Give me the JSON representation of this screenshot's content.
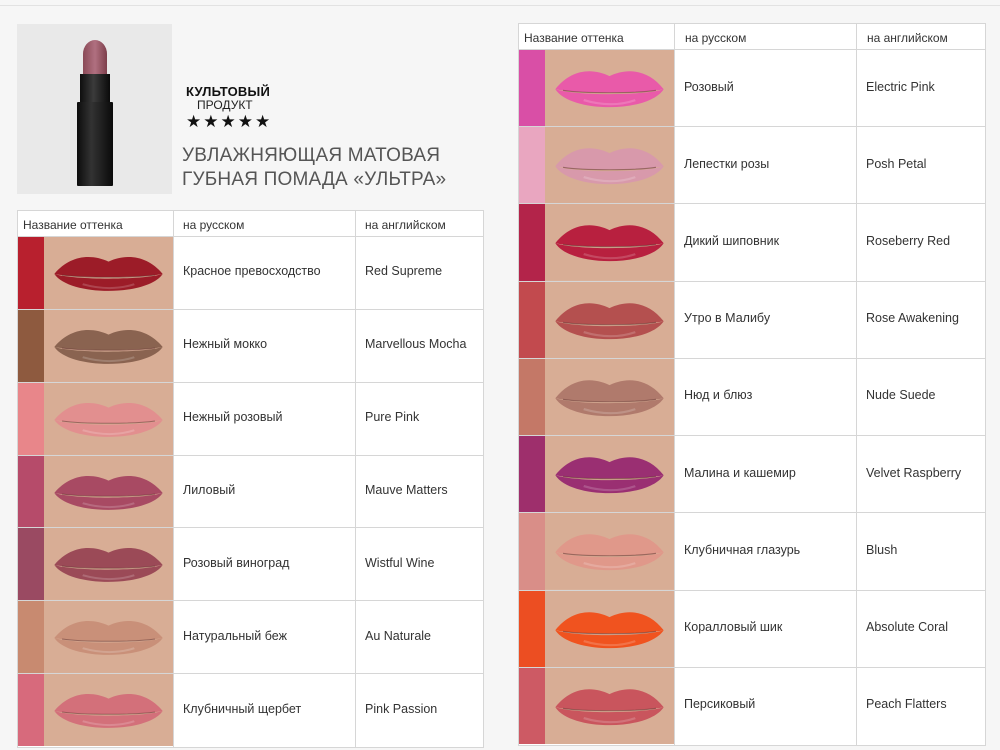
{
  "product": {
    "badge_title": "КУЛЬТОВЫЙ",
    "badge_subtitle": "ПРОДУКТ",
    "stars": "★★★★★",
    "title_line1": "УВЛАЖНЯЮЩАЯ МАТОВАЯ",
    "title_line2": "ГУБНАЯ ПОМАДА «УЛЬТРА»"
  },
  "table_headers": {
    "shade_name": "Название оттенка",
    "russian": "на русском",
    "english": "на английском"
  },
  "left_shades": [
    {
      "ru": "Красное превосходство",
      "en": "Red Supreme",
      "color": "#b8202e",
      "lip": "#9c1c28"
    },
    {
      "ru": "Нежный мокко",
      "en": "Marvellous Mocha",
      "color": "#8e5a3f",
      "lip": "#8a6350"
    },
    {
      "ru": "Нежный розовый",
      "en": "Pure Pink",
      "color": "#e8868a",
      "lip": "#e28f8f"
    },
    {
      "ru": "Лиловый",
      "en": "Mauve Matters",
      "color": "#b64b6a",
      "lip": "#a84a63"
    },
    {
      "ru": "Розовый виноград",
      "en": "Wistful Wine",
      "color": "#9a4a62",
      "lip": "#9b4a57"
    },
    {
      "ru": "Натуральный беж",
      "en": "Au Naturale",
      "color": "#c88a70",
      "lip": "#c99079"
    },
    {
      "ru": "Клубничный щербет",
      "en": "Pink Passion",
      "color": "#d76a7c",
      "lip": "#d3707a"
    }
  ],
  "right_shades": [
    {
      "ru": "Розовый",
      "en": "Electric Pink",
      "color": "#d94fa6",
      "lip": "#e95aa9"
    },
    {
      "ru": "Лепестки розы",
      "en": "Posh Petal",
      "color": "#e9a6c0",
      "lip": "#d899ab"
    },
    {
      "ru": "Дикий шиповник",
      "en": "Roseberry Red",
      "color": "#b3244a",
      "lip": "#b8203f"
    },
    {
      "ru": "Утро в Малибу",
      "en": "Rose Awakening",
      "color": "#c24a4e",
      "lip": "#b4504f"
    },
    {
      "ru": "Нюд и блюз",
      "en": "Nude Suede",
      "color": "#c47867",
      "lip": "#b07a6c"
    },
    {
      "ru": "Малина и кашемир",
      "en": "Velvet Raspberry",
      "color": "#9e2f6c",
      "lip": "#9a2f72"
    },
    {
      "ru": "Клубничная глазурь",
      "en": "Blush",
      "color": "#d98e88",
      "lip": "#e0988a"
    },
    {
      "ru": "Коралловый шик",
      "en": "Absolute Coral",
      "color": "#ec4e22",
      "lip": "#f0531f"
    },
    {
      "ru": "Персиковый",
      "en": "Peach Flatters",
      "color": "#cd5a64",
      "lip": "#c9555d"
    }
  ]
}
